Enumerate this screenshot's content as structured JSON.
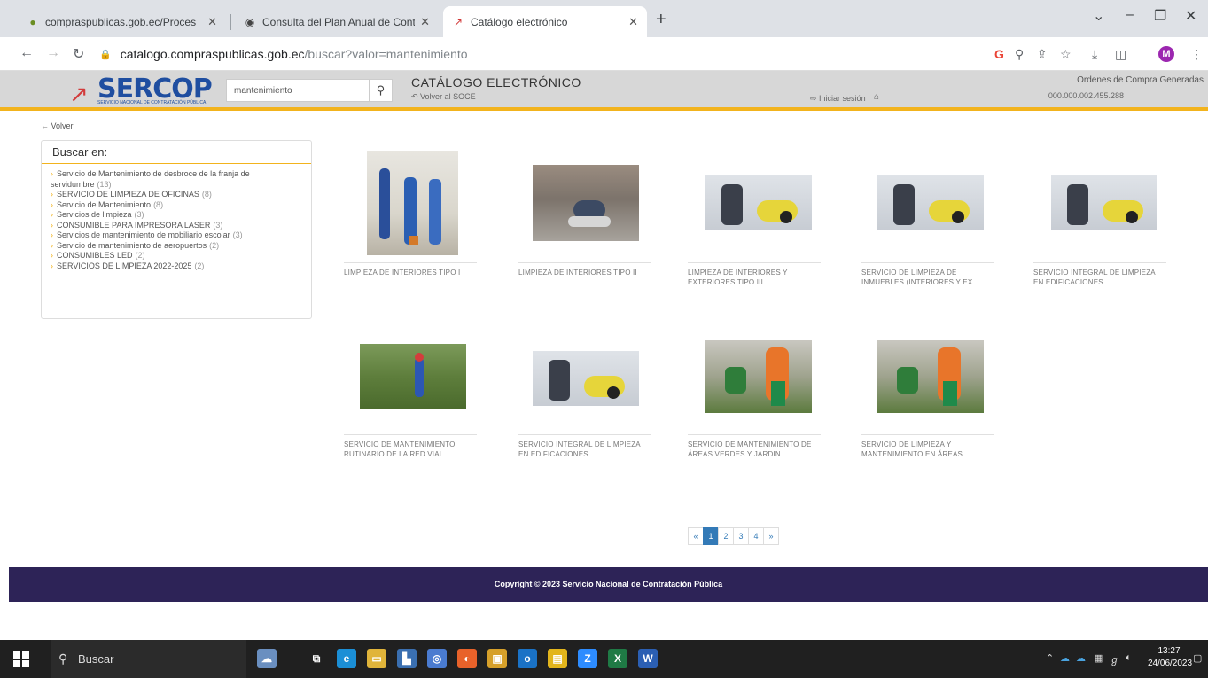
{
  "browser": {
    "tabs": [
      {
        "title": "compraspublicas.gob.ec/Proces",
        "favicon": "#6b8e23",
        "active": false
      },
      {
        "title": "Consulta del Plan Anual de Cont",
        "favicon": "#444444",
        "active": false
      },
      {
        "title": "Catálogo electrónico",
        "favicon": "#d23b3b",
        "active": true
      }
    ],
    "url_host": "catalogo.compraspublicas.gob.ec",
    "url_path": "/buscar?valor=mantenimiento",
    "profile_initial": "M"
  },
  "header": {
    "logo_text": "SERCOP",
    "logo_subtitle": "SERVICIO NACIONAL DE CONTRATACIÓN PÚBLICA",
    "search_value": "mantenimiento",
    "title": "CATÁLOGO ELECTRÓNICO",
    "back_link": "Volver al SOCE",
    "util_link": "Iniciar sesión",
    "orders_label": "Ordenes de Compra Generadas",
    "orders_value": "000.000.002.455.288"
  },
  "nav": {
    "back": "Volver"
  },
  "filters": {
    "title": "Buscar en:",
    "items": [
      {
        "label": "Servicio de Mantenimiento de desbroce de la franja de servidumbre",
        "count": "(13)"
      },
      {
        "label": "SERVICIO DE LIMPIEZA DE OFICINAS",
        "count": "(8)"
      },
      {
        "label": "Servicio de Mantenimiento",
        "count": "(8)"
      },
      {
        "label": "Servicios de limpieza",
        "count": "(3)"
      },
      {
        "label": "CONSUMIBLE PARA IMPRESORA LASER",
        "count": "(3)"
      },
      {
        "label": "Servicios de mantenimiento de mobiliario escolar",
        "count": "(3)"
      },
      {
        "label": "Servicio de mantenimiento de aeropuertos",
        "count": "(2)"
      },
      {
        "label": "CONSUMIBLES LED",
        "count": "(2)"
      },
      {
        "label": "SERVICIOS DE LIMPIEZA 2022-2025",
        "count": "(2)"
      }
    ]
  },
  "products": [
    {
      "caption": "LIMPIEZA DE INTERIORES TIPO I"
    },
    {
      "caption": "LIMPIEZA DE INTERIORES TIPO II"
    },
    {
      "caption": "LIMPIEZA DE INTERIORES Y EXTERIORES TIPO III"
    },
    {
      "caption": "SERVICIO DE LIMPIEZA DE INMUEBLES (INTERIORES Y EX..."
    },
    {
      "caption": "SERVICIO INTEGRAL DE LIMPIEZA EN EDIFICACIONES"
    },
    {
      "caption": "SERVICIO DE MANTENIMIENTO RUTINARIO DE LA RED VIAL..."
    },
    {
      "caption": "SERVICIO INTEGRAL DE LIMPIEZA EN EDIFICACIONES"
    },
    {
      "caption": "SERVICIO DE MANTENIMIENTO DE ÁREAS VERDES Y JARDIN..."
    },
    {
      "caption": "SERVICIO DE LIMPIEZA Y MANTENIMIENTO EN ÁREAS"
    }
  ],
  "pagination": {
    "prev": "«",
    "pages": [
      "1",
      "2",
      "3",
      "4"
    ],
    "next": "»",
    "current": "1"
  },
  "footer": {
    "text": "Copyright © 2023 Servicio Nacional de Contratación Pública"
  },
  "taskbar": {
    "search_placeholder": "Buscar",
    "time": "13:27",
    "date": "24/06/2023"
  },
  "colors": {
    "accent": "#f2b31d",
    "footer": "#2d2357",
    "brand": "#1f4ea0",
    "link": "#337ab7"
  }
}
